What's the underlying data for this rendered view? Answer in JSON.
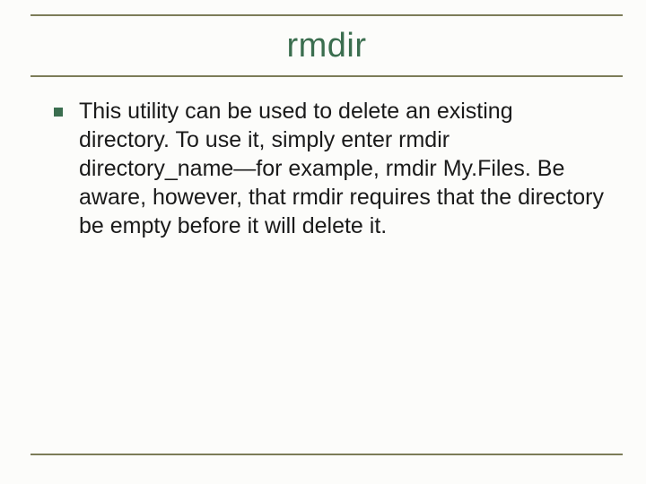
{
  "slide": {
    "title": "rmdir",
    "bullets": [
      {
        "text": " This utility can be used to delete an existing directory. To use it, simply enter rmdir directory_name—for example, rmdir My.Files. Be aware, however, that rmdir requires that the directory be empty before it will delete it."
      }
    ]
  }
}
